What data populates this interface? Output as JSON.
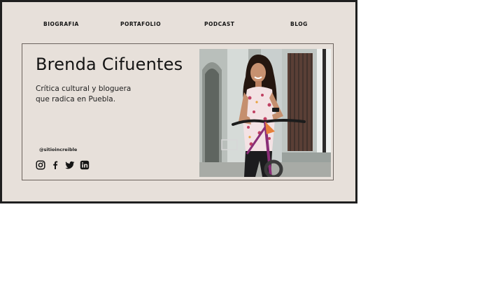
{
  "nav": {
    "items": [
      "BIOGRAFIA",
      "PORTAFOLIO",
      "PODCAST",
      "BLOG"
    ]
  },
  "hero": {
    "title": "Brenda Cifuentes",
    "subtitle_line1": "Crítica cultural y bloguera",
    "subtitle_line2": "que radica en Puebla.",
    "handle": "@sitioincreible",
    "photo_icon": "portrait-photo-woman-with-bicycle"
  },
  "social": {
    "icons": [
      "instagram-icon",
      "facebook-icon",
      "twitter-icon",
      "linkedin-icon"
    ]
  },
  "colors": {
    "background": "#e7e0da",
    "text": "#141414",
    "border": "#6b625d",
    "frame": "#1f1f1f"
  }
}
